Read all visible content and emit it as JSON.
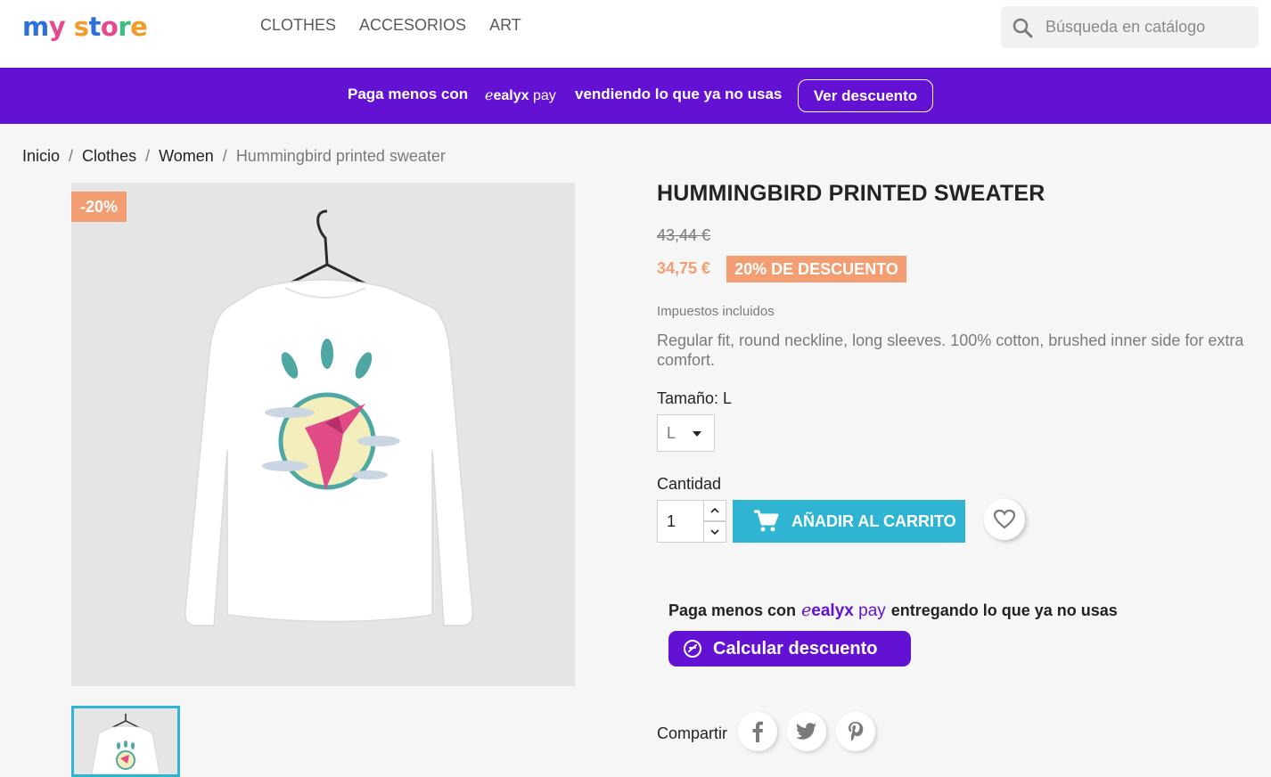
{
  "header": {
    "logo": {
      "part1": "my",
      "part2": "store"
    },
    "nav": [
      "CLOTHES",
      "ACCESORIOS",
      "ART"
    ],
    "search_placeholder": "Búsqueda en catálogo"
  },
  "banner": {
    "text_before": "Paga menos con",
    "brand_bold": "ealyx",
    "brand_light": "pay",
    "text_after": "vendiendo lo que ya no usas",
    "button": "Ver descuento"
  },
  "breadcrumb": {
    "items": [
      "Inicio",
      "Clothes",
      "Women"
    ],
    "current": "Hummingbird printed sweater",
    "separator": "/"
  },
  "product": {
    "flag": "-20%",
    "title": "HUMMINGBIRD PRINTED SWEATER",
    "old_price": "43,44 €",
    "new_price": "34,75 €",
    "discount_badge": "20% DE DESCUENTO",
    "tax_note": "Impuestos incluidos",
    "description": "Regular fit, round neckline, long sleeves. 100% cotton, brushed inner side for extra comfort.",
    "size_label": "Tamaño: L",
    "size_value": "L",
    "quantity_label": "Cantidad",
    "quantity_value": "1",
    "add_to_cart": "AÑADIR AL CARRITO"
  },
  "ealyx_block": {
    "text_before": "Paga menos con",
    "brand_bold": "ealyx",
    "brand_light": "pay",
    "text_after": "entregando lo que ya no usas",
    "button": "Calcular descuento"
  },
  "share": {
    "label": "Compartir",
    "networks": [
      "facebook",
      "twitter",
      "pinterest"
    ]
  },
  "colors": {
    "accent": "#2fb5d2",
    "ealyx_purple": "#6312d3",
    "discount": "#f39d72"
  }
}
